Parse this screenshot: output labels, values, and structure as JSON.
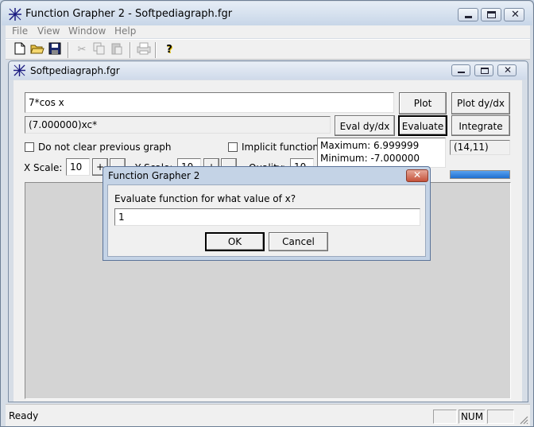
{
  "app": {
    "title": "Function Grapher 2 - Softpediagraph.fgr"
  },
  "menu": [
    "File",
    "View",
    "Window",
    "Help"
  ],
  "toolbar": {
    "icons": [
      "new-file-icon",
      "open-folder-icon",
      "save-icon",
      "cut-icon",
      "copy-icon",
      "paste-icon",
      "print-icon",
      "help-icon"
    ]
  },
  "child": {
    "title": "Softpediagraph.fgr"
  },
  "form": {
    "function_value": "7*cos x",
    "derivative_value": "(7.000000)xc*",
    "plot_label": "Plot",
    "plot_dydx_label": "Plot dy/dx",
    "eval_dydx_label": "Eval dy/dx",
    "evaluate_label": "Evaluate",
    "integrate_label": "Integrate",
    "no_clear_label": "Do not clear previous graph",
    "implicit_label": "Implicit function",
    "info_max": "Maximum: 6.999999",
    "info_min": "Minimum: -7.000000",
    "coords": "(14,11)",
    "xscale_label": "X Scale:",
    "xscale_value": "10",
    "yscale_label": "Y Scale:",
    "yscale_value": "10",
    "quality_label": "Quality:",
    "quality_value": "10",
    "plus": "+",
    "minus": "-",
    "progress_fraction": 1.0
  },
  "dialog": {
    "title": "Function Grapher 2",
    "prompt": "Evaluate function for what value of x?",
    "value": "1",
    "ok_label": "OK",
    "cancel_label": "Cancel"
  },
  "status": {
    "text": "Ready",
    "num": "NUM"
  },
  "colors": {
    "progress": "#2b7de0",
    "close_button": "#c5523b",
    "graph_bg": "#d4d4d4"
  }
}
